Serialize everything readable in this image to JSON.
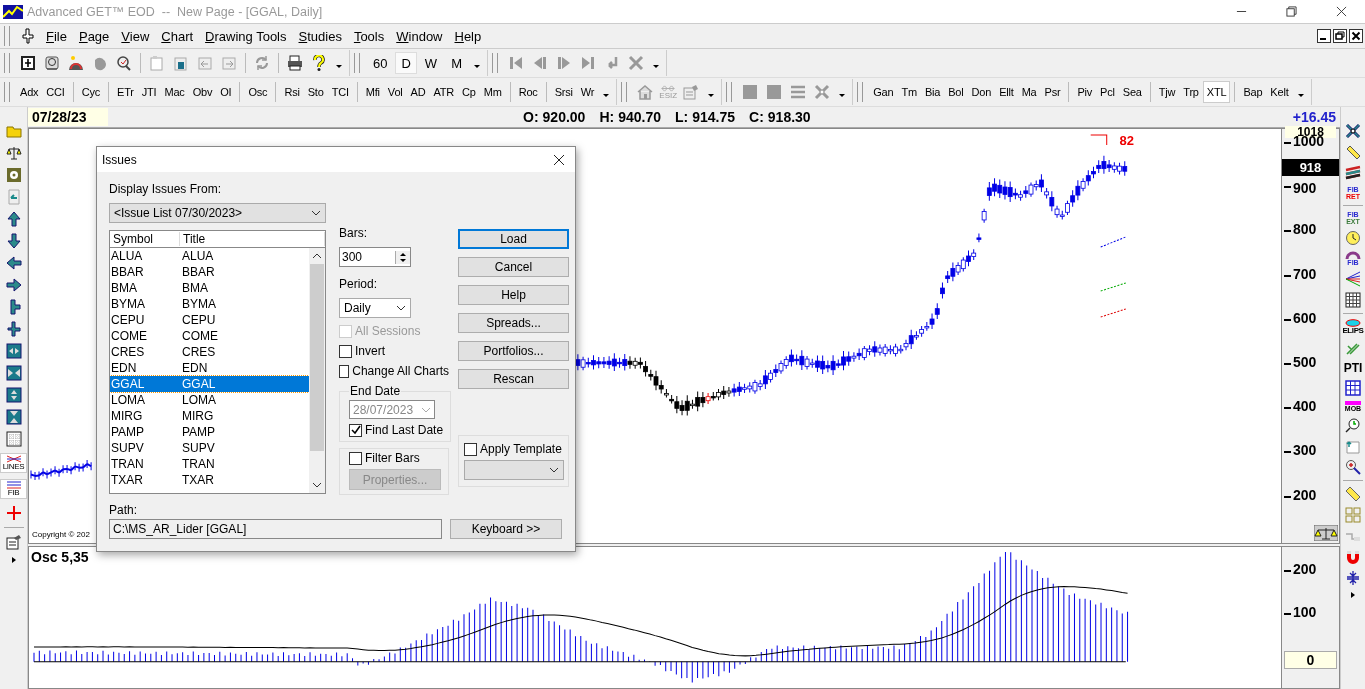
{
  "window": {
    "title": "Advanced GET™ EOD  --  New Page - [GGAL, Daily]"
  },
  "menu": [
    "File",
    "Page",
    "View",
    "Chart",
    "Drawing Tools",
    "Studies",
    "Tools",
    "Window",
    "Help"
  ],
  "periods": [
    {
      "label": "60",
      "selected": false
    },
    {
      "label": "D",
      "selected": true
    },
    {
      "label": "W",
      "selected": false
    },
    {
      "label": "M",
      "selected": false
    }
  ],
  "esiz_caption": "ESIZ",
  "studies_left": [
    [
      {
        "label": "Adx",
        "selected": false
      },
      {
        "label": "CCI",
        "selected": false
      }
    ],
    [
      {
        "label": "Cyc",
        "selected": false
      }
    ],
    [
      {
        "label": "ETr",
        "selected": false
      },
      {
        "label": "JTI",
        "selected": false
      },
      {
        "label": "Mac",
        "selected": false
      },
      {
        "label": "Obv",
        "selected": false
      },
      {
        "label": "OI",
        "selected": false
      }
    ],
    [
      {
        "label": "Osc",
        "selected": false
      }
    ],
    [
      {
        "label": "Rsi",
        "selected": false
      },
      {
        "label": "Sto",
        "selected": false
      },
      {
        "label": "TCI",
        "selected": false
      }
    ],
    [
      {
        "label": "Mfi",
        "selected": false
      },
      {
        "label": "Vol",
        "selected": false
      },
      {
        "label": "AD",
        "selected": false
      },
      {
        "label": "ATR",
        "selected": false
      },
      {
        "label": "Cp",
        "selected": false
      },
      {
        "label": "Mm",
        "selected": false
      }
    ],
    [
      {
        "label": "Roc",
        "selected": false
      }
    ],
    [
      {
        "label": "Srsi",
        "selected": false
      },
      {
        "label": "Wr",
        "selected": false
      }
    ]
  ],
  "studies_right": [
    [
      {
        "label": "Gan",
        "selected": false
      },
      {
        "label": "Tm",
        "selected": false
      },
      {
        "label": "Bia",
        "selected": false
      },
      {
        "label": "Bol",
        "selected": false
      },
      {
        "label": "Don",
        "selected": false
      },
      {
        "label": "Ellt",
        "selected": false
      },
      {
        "label": "Ma",
        "selected": false
      },
      {
        "label": "Psr",
        "selected": false
      }
    ],
    [
      {
        "label": "Piv",
        "selected": false
      },
      {
        "label": "Pcl",
        "selected": false
      },
      {
        "label": "Sea",
        "selected": false
      }
    ],
    [
      {
        "label": "Tjw",
        "selected": false
      },
      {
        "label": "Trp",
        "selected": false
      },
      {
        "label": "XTL",
        "selected": true
      }
    ],
    [
      {
        "label": "Bap",
        "selected": false
      },
      {
        "label": "Kelt",
        "selected": false
      }
    ]
  ],
  "left_toolbar": {
    "lines_caption": "LINES",
    "fib_caption": "FIB"
  },
  "right_toolbar": {
    "fib_ret": [
      "FIB",
      "RET"
    ],
    "fib_ext": [
      "FIB",
      "EXT"
    ],
    "fib_arc": "FIB",
    "elips": "ELIPS",
    "pti": "PTI",
    "mob": "MOB"
  },
  "chart_header": {
    "date": "07/28/23",
    "quote": [
      {
        "label": "O:",
        "value": "920.00"
      },
      {
        "label": "H:",
        "value": "940.70"
      },
      {
        "label": "L:",
        "value": "914.75"
      },
      {
        "label": "C:",
        "value": "918.30"
      }
    ],
    "change": "+16.45"
  },
  "price_pane": {
    "top_label": "1018",
    "last_price": "918",
    "ticks": [
      "1000",
      "900",
      "800",
      "700",
      "600",
      "500",
      "400",
      "300",
      "200"
    ],
    "marker": "82",
    "copyright": "Copyright © 202"
  },
  "osc_pane": {
    "title": "Osc 5,35",
    "ticks": [
      "200",
      "100"
    ],
    "zero_label": "0"
  },
  "dialog": {
    "title": "Issues",
    "source_label": "Display Issues From:",
    "source_value": "<Issue List 07/30/2023>",
    "columns": [
      "Symbol",
      "Title"
    ],
    "rows": [
      {
        "symbol": "ALUA",
        "title": "ALUA",
        "selected": false
      },
      {
        "symbol": "BBAR",
        "title": "BBAR",
        "selected": false
      },
      {
        "symbol": "BMA",
        "title": "BMA",
        "selected": false
      },
      {
        "symbol": "BYMA",
        "title": "BYMA",
        "selected": false
      },
      {
        "symbol": "CEPU",
        "title": "CEPU",
        "selected": false
      },
      {
        "symbol": "COME",
        "title": "COME",
        "selected": false
      },
      {
        "symbol": "CRES",
        "title": "CRES",
        "selected": false
      },
      {
        "symbol": "EDN",
        "title": "EDN",
        "selected": false
      },
      {
        "symbol": "GGAL",
        "title": "GGAL",
        "selected": true
      },
      {
        "symbol": "LOMA",
        "title": "LOMA",
        "selected": false
      },
      {
        "symbol": "MIRG",
        "title": "MIRG",
        "selected": false
      },
      {
        "symbol": "PAMP",
        "title": "PAMP",
        "selected": false
      },
      {
        "symbol": "SUPV",
        "title": "SUPV",
        "selected": false
      },
      {
        "symbol": "TRAN",
        "title": "TRAN",
        "selected": false
      },
      {
        "symbol": "TXAR",
        "title": "TXAR",
        "selected": false
      }
    ],
    "bars_label": "Bars:",
    "bars_value": "300",
    "period_label": "Period:",
    "period_value": "Daily",
    "options": [
      {
        "label": "All Sessions",
        "checked": false,
        "disabled": true
      },
      {
        "label": "Invert",
        "checked": false,
        "disabled": false
      },
      {
        "label": "Change All Charts",
        "checked": false,
        "disabled": false
      }
    ],
    "end_date": {
      "legend": "End Date",
      "value": "28/07/2023",
      "disabled": true,
      "find_last": {
        "label": "Find Last Date",
        "checked": true
      }
    },
    "filter_bars": {
      "label": "Filter Bars",
      "checked": false,
      "button": "Properties..."
    },
    "buttons": [
      {
        "label": "Load",
        "default": true
      },
      {
        "label": "Cancel",
        "default": false
      },
      {
        "label": "Help",
        "default": false
      },
      {
        "label": "Spreads...",
        "default": false
      },
      {
        "label": "Portfolios...",
        "default": false
      },
      {
        "label": "Rescan",
        "default": false
      }
    ],
    "apply_template": {
      "label": "Apply Template",
      "checked": false
    },
    "path_label": "Path:",
    "path_value": "C:\\MS_AR_Lider [GGAL]",
    "keyboard_button": "Keyboard >>"
  }
}
